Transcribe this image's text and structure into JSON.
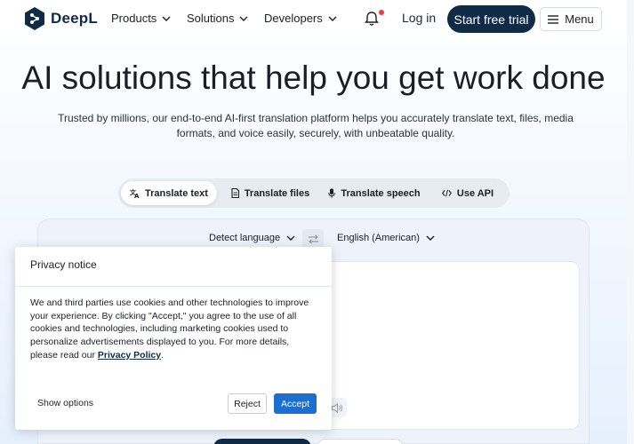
{
  "nav": {
    "logo_text": "DeepL",
    "products": "Products",
    "solutions": "Solutions",
    "developers": "Developers",
    "login": "Log in",
    "start_trial": "Start free trial",
    "menu": "Menu"
  },
  "hero": {
    "title": "AI solutions that help you get work done",
    "subtitle": "Trusted by millions, our end-to-end AI-first translation platform helps you accurately translate text, files, media formats, and voice easily, securely, with unbeatable quality."
  },
  "tabs": [
    {
      "label": "Translate text",
      "icon": "translate-icon",
      "active": true
    },
    {
      "label": "Translate files",
      "icon": "file-icon",
      "active": false
    },
    {
      "label": "Translate speech",
      "icon": "microphone-icon",
      "active": false
    },
    {
      "label": "Use API",
      "icon": "code-icon",
      "active": false
    }
  ],
  "translator": {
    "source_lang": "Detect language",
    "target_lang": "English (American)"
  },
  "privacy": {
    "title": "Privacy notice",
    "body_text": "We and third parties use cookies and other technologies to improve your experience. By clicking \"Accept,\" you agree to the use of all cookies and technologies, including marketing cookies used to personalize advertisements displayed to you. For more details, please read our ",
    "policy_link": "Privacy Policy",
    "body_end": ".",
    "show_options": "Show options",
    "reject": "Reject",
    "accept": "Accept"
  },
  "colors": {
    "brand_navy": "#0f2b46",
    "accent_blue": "#1a6fd1",
    "notification_dot": "#e8413a"
  }
}
